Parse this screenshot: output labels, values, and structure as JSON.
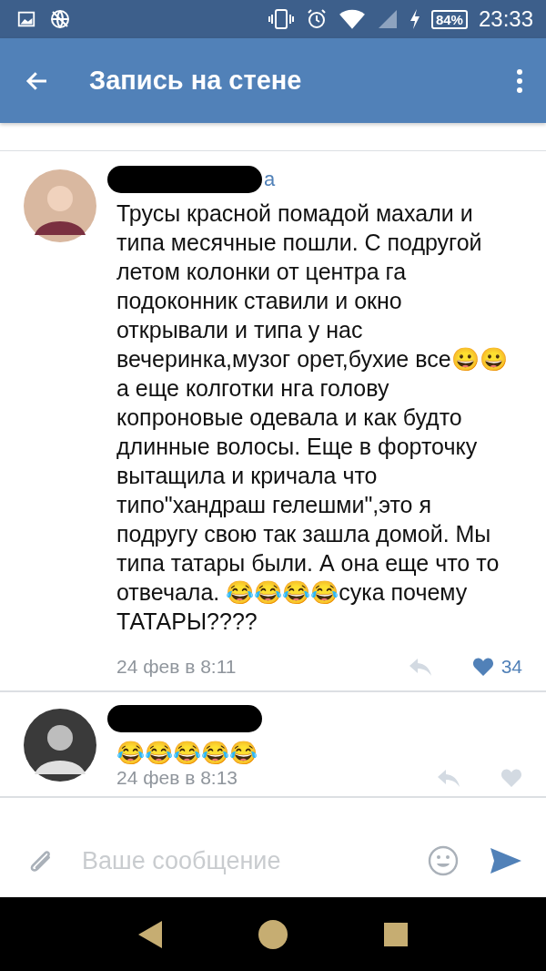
{
  "status_bar": {
    "battery": "84%",
    "time": "23:33"
  },
  "app_bar": {
    "title": "Запись на стене"
  },
  "comments": [
    {
      "author": "а",
      "author_redacted": true,
      "text": "Трусы красной помадой махали и типа месячные пошли. С подругой летом колонки от центра га подоконник ставили и окно открывали и типа у нас вечеринка,музог орет,бухие все😀😀а еще колготки нга голову копроновые одевала и как будто длинные волосы. Еще в форточку вытащила и кричала что типо\"хандраш гелешми\",это я подругу свою так зашла домой. Мы типа татары были.  А она еще что то отвечала.  😂😂😂😂сука почему ТАТАРЫ????",
      "date": "24 фев в 8:11",
      "liked": true,
      "likes": "34"
    },
    {
      "author_redacted": true,
      "text": "😂😂😂😂😂",
      "date": "24 фев в 8:13",
      "liked": false
    }
  ],
  "composer": {
    "placeholder": "Ваше сообщение"
  }
}
